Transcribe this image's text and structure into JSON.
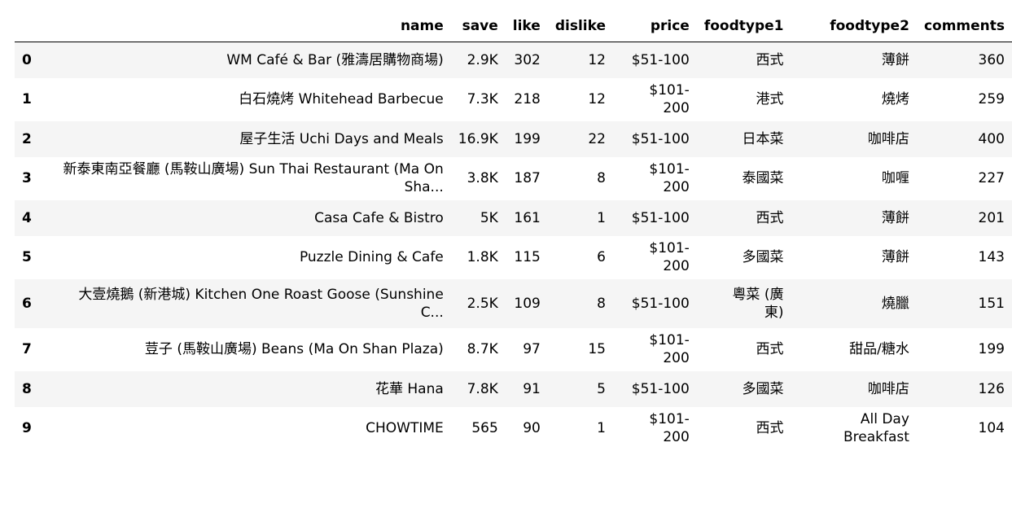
{
  "table": {
    "columns": [
      "name",
      "save",
      "like",
      "dislike",
      "price",
      "foodtype1",
      "foodtype2",
      "comments"
    ],
    "rows": [
      {
        "index": "0",
        "name": "WM Café & Bar (雅濤居購物商場)",
        "save": "2.9K",
        "like": "302",
        "dislike": "12",
        "price": "$51-100",
        "foodtype1": "西式",
        "foodtype2": "薄餅",
        "comments": "360"
      },
      {
        "index": "1",
        "name": "白石燒烤 Whitehead Barbecue",
        "save": "7.3K",
        "like": "218",
        "dislike": "12",
        "price": "$101-200",
        "foodtype1": "港式",
        "foodtype2": "燒烤",
        "comments": "259"
      },
      {
        "index": "2",
        "name": "屋子生活 Uchi Days and Meals",
        "save": "16.9K",
        "like": "199",
        "dislike": "22",
        "price": "$51-100",
        "foodtype1": "日本菜",
        "foodtype2": "咖啡店",
        "comments": "400"
      },
      {
        "index": "3",
        "name": "新泰東南亞餐廳 (馬鞍山廣場) Sun Thai Restaurant (Ma On Sha...",
        "save": "3.8K",
        "like": "187",
        "dislike": "8",
        "price": "$101-200",
        "foodtype1": "泰國菜",
        "foodtype2": "咖喱",
        "comments": "227"
      },
      {
        "index": "4",
        "name": "Casa Cafe & Bistro",
        "save": "5K",
        "like": "161",
        "dislike": "1",
        "price": "$51-100",
        "foodtype1": "西式",
        "foodtype2": "薄餅",
        "comments": "201"
      },
      {
        "index": "5",
        "name": "Puzzle Dining & Cafe",
        "save": "1.8K",
        "like": "115",
        "dislike": "6",
        "price": "$101-200",
        "foodtype1": "多國菜",
        "foodtype2": "薄餅",
        "comments": "143"
      },
      {
        "index": "6",
        "name": "大壹燒鵝 (新港城) Kitchen One Roast Goose (Sunshine C...",
        "save": "2.5K",
        "like": "109",
        "dislike": "8",
        "price": "$51-100",
        "foodtype1": "粵菜 (廣東)",
        "foodtype2": "燒臘",
        "comments": "151"
      },
      {
        "index": "7",
        "name": "荳子 (馬鞍山廣場) Beans (Ma On Shan Plaza)",
        "save": "8.7K",
        "like": "97",
        "dislike": "15",
        "price": "$101-200",
        "foodtype1": "西式",
        "foodtype2": "甜品/糖水",
        "comments": "199"
      },
      {
        "index": "8",
        "name": "花華 Hana",
        "save": "7.8K",
        "like": "91",
        "dislike": "5",
        "price": "$51-100",
        "foodtype1": "多國菜",
        "foodtype2": "咖啡店",
        "comments": "126"
      },
      {
        "index": "9",
        "name": "CHOWTIME",
        "save": "565",
        "like": "90",
        "dislike": "1",
        "price": "$101-200",
        "foodtype1": "西式",
        "foodtype2": "All Day Breakfast",
        "comments": "104"
      }
    ]
  }
}
